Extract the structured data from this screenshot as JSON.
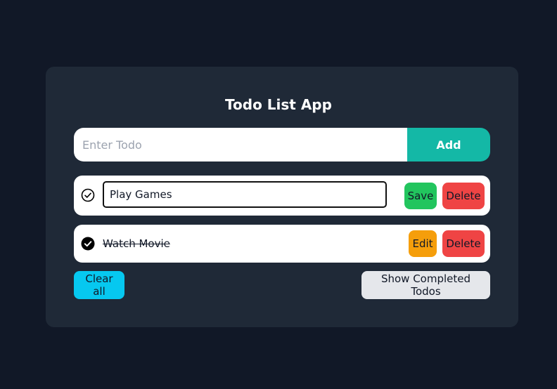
{
  "app": {
    "title": "Todo List App"
  },
  "add_form": {
    "placeholder": "Enter Todo",
    "value": "",
    "add_label": "Add"
  },
  "todos": [
    {
      "text": "Play Games",
      "completed": false,
      "editing": true,
      "check_icon": "circle-check-outline-icon",
      "save_label": "Save",
      "delete_label": "Delete"
    },
    {
      "text": "Watch Movie",
      "completed": true,
      "editing": false,
      "check_icon": "circle-check-filled-icon",
      "edit_label": "Edit",
      "delete_label": "Delete"
    }
  ],
  "footer": {
    "clear_label": "Clear all",
    "show_completed_label": "Show Completed Todos"
  },
  "colors": {
    "page_bg": "#111827",
    "card_bg": "#1f2937",
    "add_button": "#14b8a6",
    "save_button": "#22c55e",
    "edit_button": "#f59e0b",
    "delete_button": "#ef4444",
    "clear_button": "#06c8f0",
    "show_completed_button": "#e5e7eb"
  }
}
